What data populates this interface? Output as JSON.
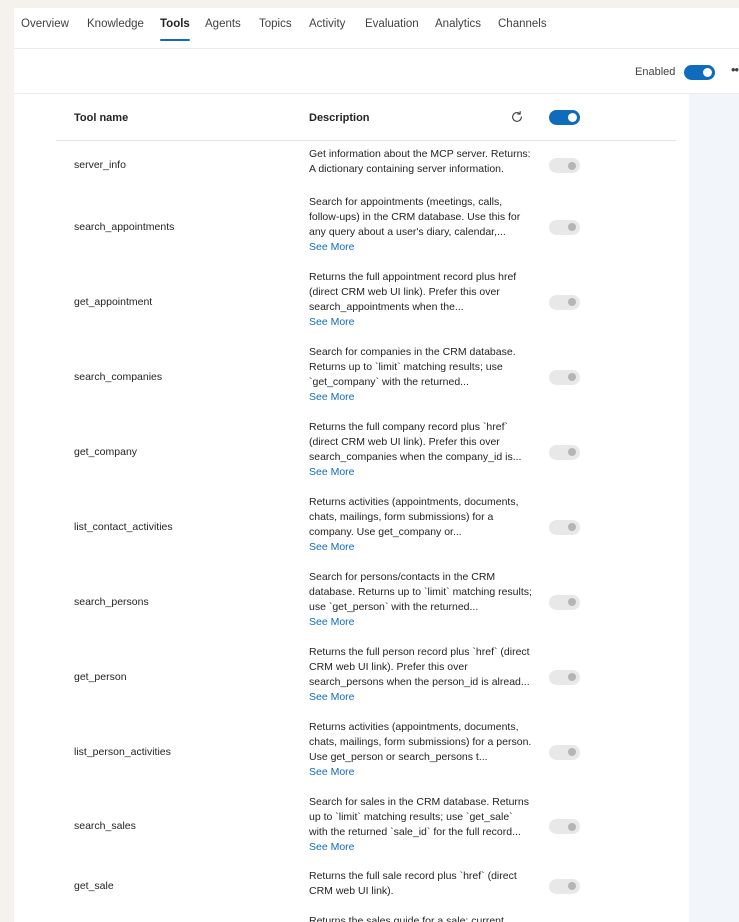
{
  "tabs": [
    "Overview",
    "Knowledge",
    "Tools",
    "Agents",
    "Topics",
    "Activity",
    "Evaluation",
    "Analytics",
    "Channels"
  ],
  "active_tab": "Tools",
  "toolbar": {
    "enabled_label": "Enabled",
    "enabled": true
  },
  "table": {
    "header": {
      "name": "Tool name",
      "description": "Description",
      "all_enabled": true
    },
    "see_more_label": "See More",
    "rows": [
      {
        "name": "server_info",
        "description": "Get information about the MCP server. Returns: A dictionary containing server information.",
        "see_more": false,
        "enabled": false
      },
      {
        "name": "search_appointments",
        "description": "Search for appointments (meetings, calls, follow-ups) in the CRM database. Use this for any query about a user's diary, calendar,...",
        "see_more": true,
        "enabled": false
      },
      {
        "name": "get_appointment",
        "description": "Returns the full appointment record plus href (direct CRM web UI link). Prefer this over search_appointments when the...",
        "see_more": true,
        "enabled": false
      },
      {
        "name": "search_companies",
        "description": "Search for companies in the CRM database. Returns up to `limit` matching results; use `get_company` with the returned...",
        "see_more": true,
        "enabled": false
      },
      {
        "name": "get_company",
        "description": "Returns the full company record plus `href` (direct CRM web UI link). Prefer this over search_companies when the company_id is...",
        "see_more": true,
        "enabled": false
      },
      {
        "name": "list_contact_activities",
        "description": "Returns activities (appointments, documents, chats, mailings, form submissions) for a company. Use get_company or...",
        "see_more": true,
        "enabled": false
      },
      {
        "name": "search_persons",
        "description": "Search for persons/contacts in the CRM database. Returns up to `limit` matching results; use `get_person` with the returned...",
        "see_more": true,
        "enabled": false
      },
      {
        "name": "get_person",
        "description": "Returns the full person record plus `href` (direct CRM web UI link). Prefer this over search_persons when the person_id is alread...",
        "see_more": true,
        "enabled": false
      },
      {
        "name": "list_person_activities",
        "description": "Returns activities (appointments, documents, chats, mailings, form submissions) for a person. Use get_person or search_persons t...",
        "see_more": true,
        "enabled": false
      },
      {
        "name": "search_sales",
        "description": "Search for sales in the CRM database. Returns up to `limit` matching results; use `get_sale` with the returned `sale_id` for the full record...",
        "see_more": true,
        "enabled": false
      },
      {
        "name": "get_sale",
        "description": "Returns the full sale record plus `href` (direct CRM web UI link).",
        "see_more": false,
        "enabled": false
      },
      {
        "name": "",
        "description": "Returns the sales guide for a sale: current",
        "see_more": false,
        "enabled": false
      }
    ]
  },
  "colors": {
    "accent": "#0f6cbd",
    "page_bg": "#f5f1ed",
    "toggle_off": "#e8e8e8"
  },
  "icons": {
    "refresh": "refresh-icon",
    "more": "more-icon"
  }
}
